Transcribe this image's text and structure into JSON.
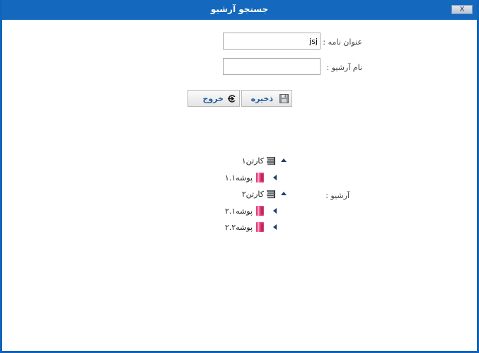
{
  "window": {
    "title": "جستجو آرشیو",
    "close_label": "X"
  },
  "form": {
    "name_title_label": "عنوان نامه :",
    "name_title_value": "jsj",
    "archive_name_label": "نام آرشیو :",
    "archive_name_value": "",
    "archive_label": "آرشیو :"
  },
  "buttons": {
    "save_label": "ذخیره",
    "exit_label": "خروج"
  },
  "tree": {
    "cartons": [
      {
        "label": "کارتن۱",
        "folders": [
          {
            "label": "پوشه۱.۱"
          }
        ]
      },
      {
        "label": "کارتن۲",
        "folders": [
          {
            "label": "پوشه۲.۱"
          },
          {
            "label": "پوشه۲.۲"
          }
        ]
      }
    ]
  },
  "colors": {
    "titlebar": "#1468bd",
    "button_text": "#245c9e",
    "folder_icon": "#d6336c"
  }
}
